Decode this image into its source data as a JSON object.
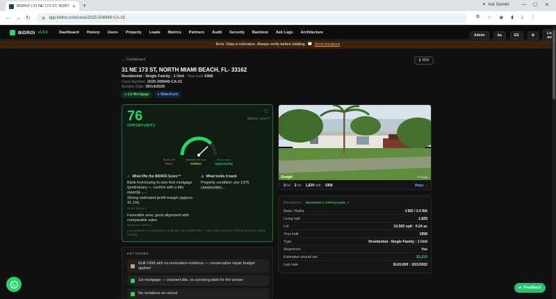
{
  "browser": {
    "tab_title": "BIDROI | 31 NE 173 ST, NORT",
    "url": "app.bidroi.com/case/2025-008949-CA-01",
    "gemini_label": "Ask Gemini"
  },
  "nav": {
    "logo_text": "BIDROI",
    "version": "v1.3.0",
    "items": [
      "Dashboard",
      "History",
      "Users",
      "Property",
      "Leads",
      "Metrics",
      "Partners",
      "Audit",
      "Security",
      "Backtest",
      "Ask Logs",
      "Architecture"
    ],
    "admin_label": "Admin",
    "font_size_label": "Aa",
    "lang_label": "ES",
    "logout_label": "Log out"
  },
  "beta": {
    "label": "Beta",
    "text": "Data is indicative. Always verify before bidding.",
    "feedback_link": "Send feedback"
  },
  "case": {
    "back_label": "← Dashboard",
    "pdf_label": "⬇ PDF",
    "address": "31 NE 173 ST, NORTH MIAMI BEACH, FL- 33162",
    "property_type": "Residential - Single Family : 1 Unit",
    "year_label": "Year built",
    "year_built": "1958",
    "case_label": "Case Number:",
    "case_number": "2025-008949-CA-01",
    "auction_label": "Auction Date:",
    "auction_date": "09/14/2026",
    "tags": [
      "1st Mortgage",
      "Waterfront"
    ]
  },
  "score": {
    "value": "76",
    "label": "OPPORTUNITY",
    "brand": "BIDROI Score™",
    "gauge_fraction": 0.76,
    "zones": [
      {
        "range": "Below 40",
        "label": "Pass",
        "color": "#e0453a"
      },
      {
        "range": "Between 40 and 59",
        "label": "Review",
        "color": "#e0b43a"
      },
      {
        "range": "60 or more",
        "label": "Opportunity",
        "color": "#2bd36b"
      }
    ],
    "lifts_title": "What lifts the BIDROI Score™",
    "lifts": [
      {
        "text": "Bank foreclosing to own first mortgage (preliminary — confirm with a title search)",
        "impact": "HIGH IMPACT"
      },
      {
        "text": "Strong estimated profit margin (approx. 41.1%)",
        "impact": "HIGH IMPACT"
      },
      {
        "text": "Favorable area, good alignment with comparable sales",
        "impact": "MEDIUM IMPACT"
      }
    ],
    "holds_title": "What holds it back",
    "holds": [
      {
        "text": "Property condition: pre-1976 construction",
        "impact": "MEDIUM IMPACT"
      }
    ],
    "note": "Lien position is a preliminary indicator, not verified title — get a title search in Official Records before bidding."
  },
  "issues": {
    "title": "KEY ISSUES",
    "items": [
      {
        "text": "Built 1958 with no renovation evidence — conservative repair budget applied",
        "icon": "house-icon",
        "color": "#c8a070"
      },
      {
        "text": "1st mortgage — cleanest title, no surviving debt for the winner",
        "icon": "check-icon",
        "color": "#2bd36b"
      },
      {
        "text": "No violations on record",
        "icon": "check-icon",
        "color": "#2bd36b"
      }
    ]
  },
  "photo": {
    "stats": [
      {
        "value": "3",
        "unit": "bd"
      },
      {
        "value": "2",
        "unit": "ba"
      },
      {
        "value": "1,829",
        "unit": "sqft"
      },
      {
        "value": "1958",
        "unit": ""
      }
    ],
    "maps_label": "Maps →",
    "google_label": "Google",
    "copyright": "© Google"
  },
  "property": {
    "label": "PROPERTY",
    "appraiser_link": "PROPERTY APPRAISER ↗",
    "rows": [
      {
        "k": "Beds / Baths",
        "v": "3 BD / 2.0 BA"
      },
      {
        "k": "Living sqft",
        "v": "1,829"
      },
      {
        "k": "Lot",
        "v": "10,500 sqft · 0.24 ac"
      },
      {
        "k": "Year built",
        "v": "1958"
      },
      {
        "k": "Type",
        "v": "Residential - Single Family : 1 Unit"
      },
      {
        "k": "Waterfront",
        "v": "Yes"
      },
      {
        "k": "Estimated annual tax",
        "v": "$1,619"
      },
      {
        "k": "Last sale",
        "v": "$120,000 · 10/1/2002"
      }
    ]
  },
  "feedback_label": "Feedback"
}
